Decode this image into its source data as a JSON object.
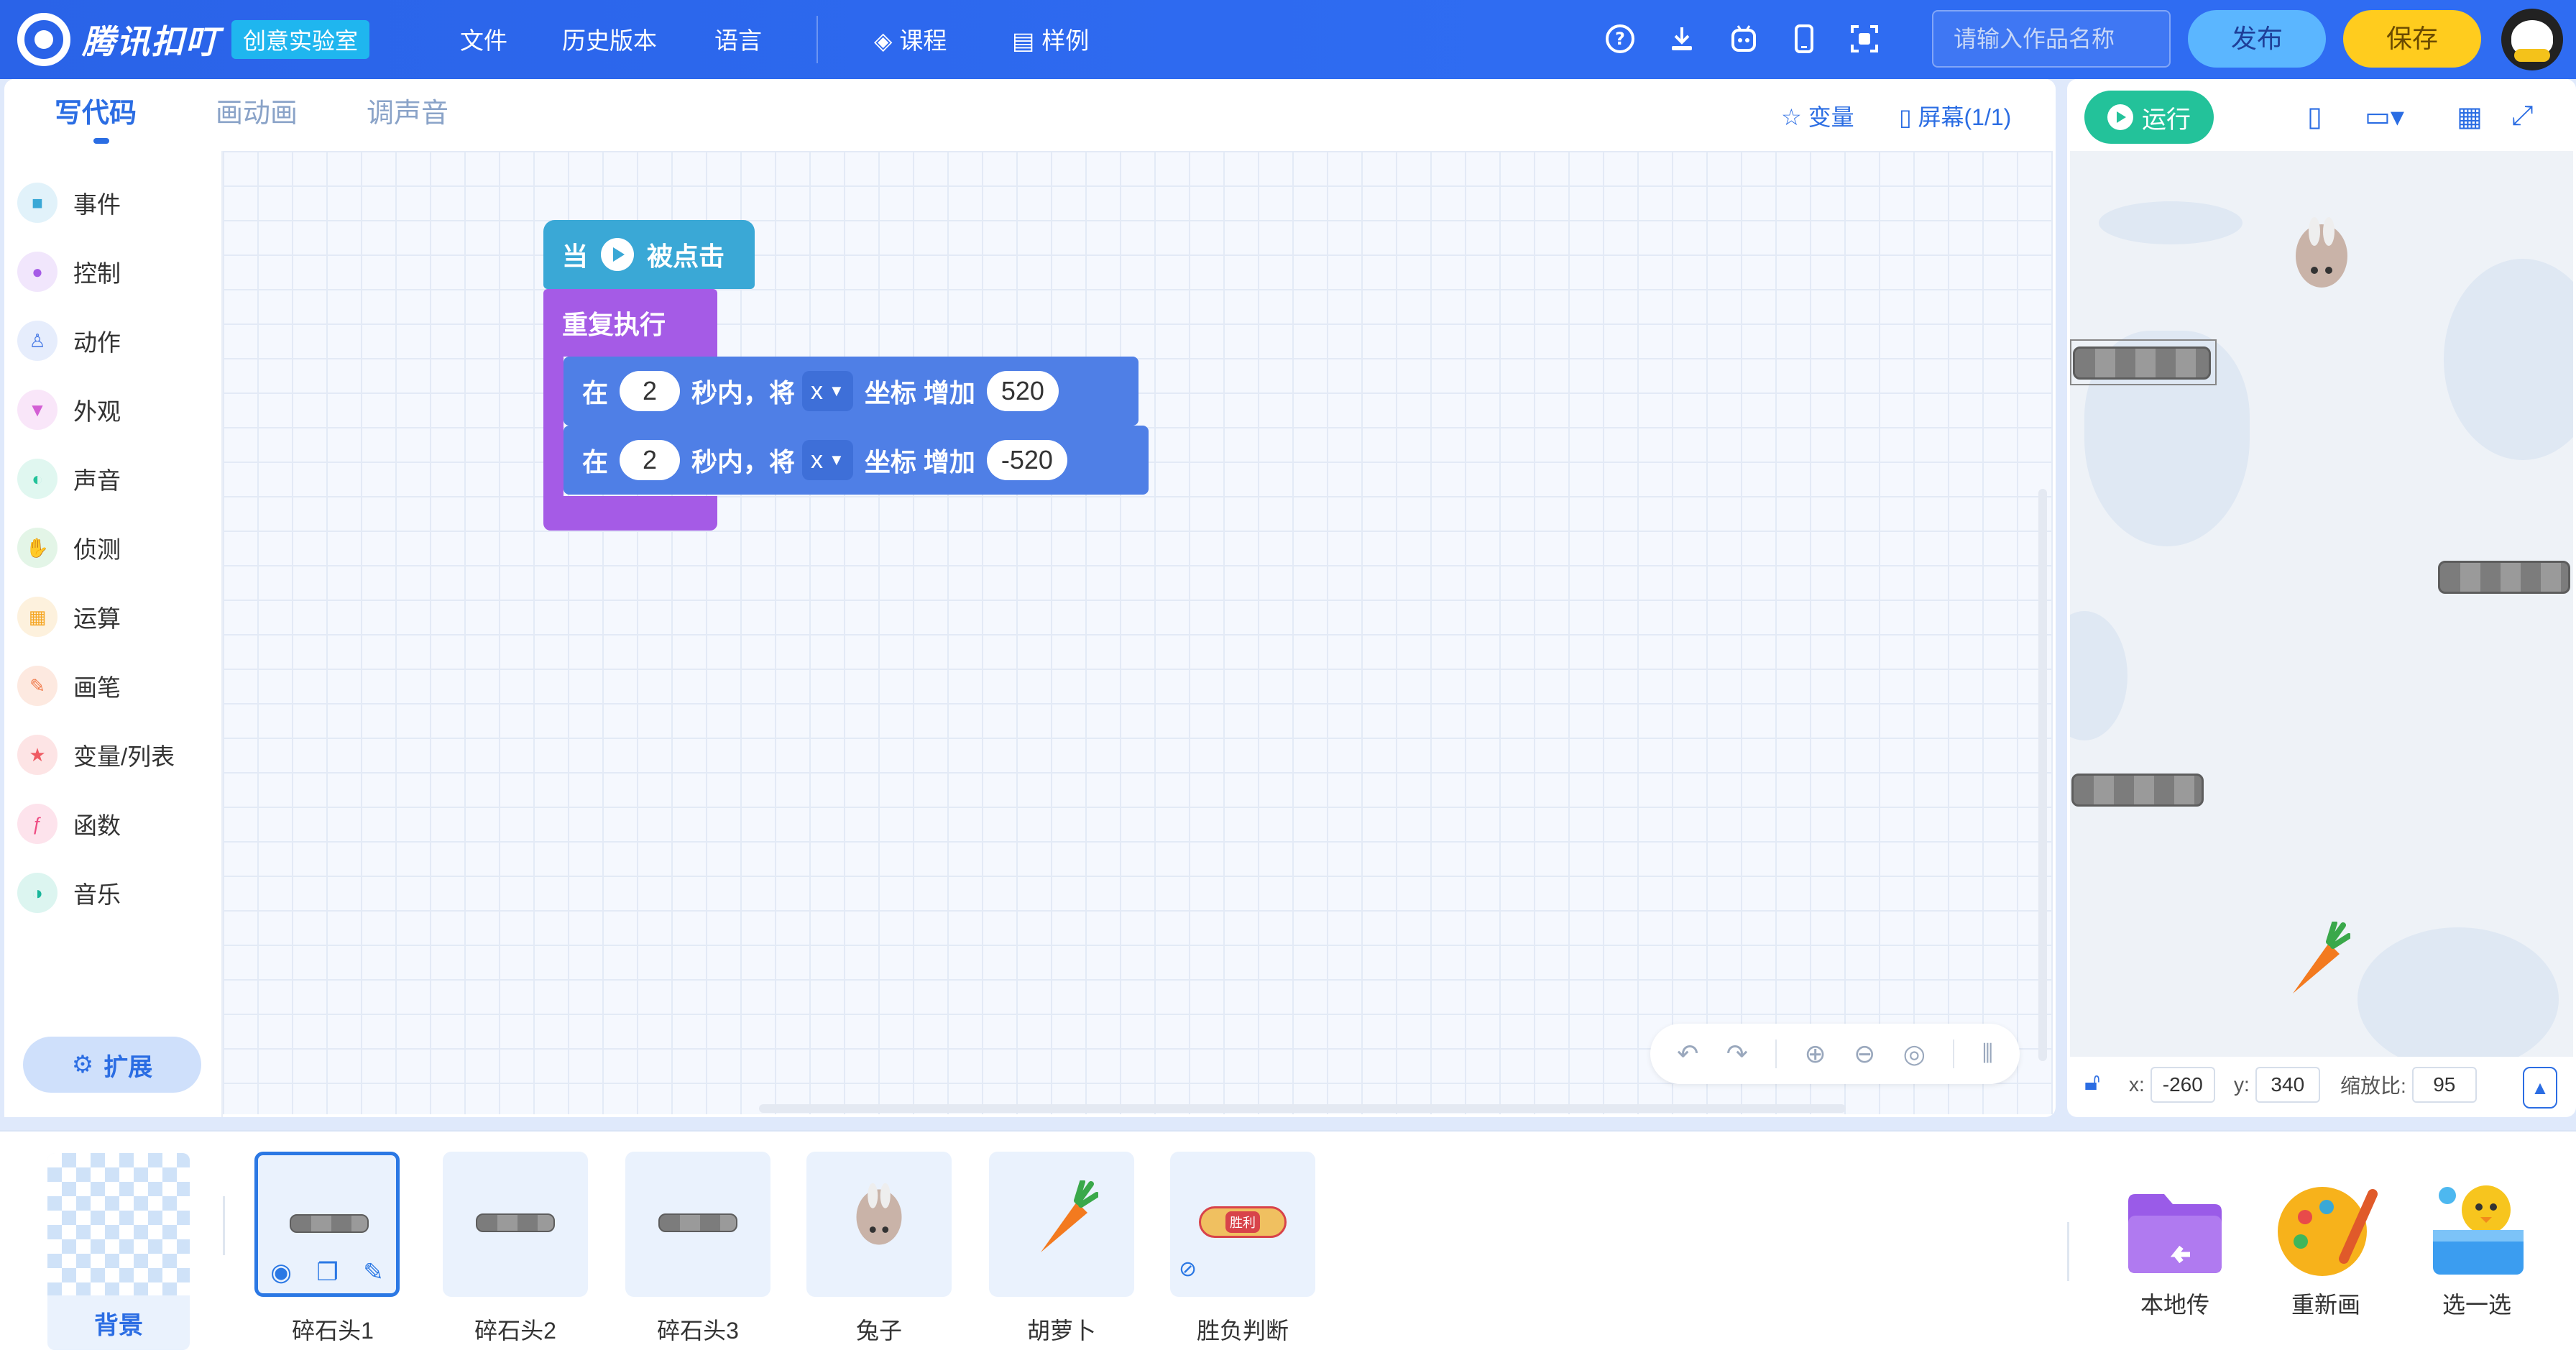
{
  "app": {
    "name": "腾讯扣叮",
    "badge": "创意实验室"
  },
  "menu": {
    "file": "文件",
    "history": "历史版本",
    "language": "语言",
    "course": "课程",
    "examples": "样例"
  },
  "topbar": {
    "search_placeholder": "请输入作品名称",
    "publish": "发布",
    "save": "保存"
  },
  "tabs": [
    "写代码",
    "画动画",
    "调声音"
  ],
  "code_tools": {
    "variables": "变量",
    "screen": "屏幕(1/1)"
  },
  "categories": [
    {
      "label": "事件",
      "color": "#3aa8d6"
    },
    {
      "label": "控制",
      "color": "#a55be6"
    },
    {
      "label": "动作",
      "color": "#4f7fe6"
    },
    {
      "label": "外观",
      "color": "#d35fd4"
    },
    {
      "label": "声音",
      "color": "#23c29a"
    },
    {
      "label": "侦测",
      "color": "#3fb65b"
    },
    {
      "label": "运算",
      "color": "#f5a623"
    },
    {
      "label": "画笔",
      "color": "#f07a4a"
    },
    {
      "label": "变量/列表",
      "color": "#ef5a62"
    },
    {
      "label": "函数",
      "color": "#ee4b82"
    },
    {
      "label": "音乐",
      "color": "#18b69a"
    }
  ],
  "extend": "扩展",
  "blocks": {
    "hat": {
      "when": "当",
      "clicked": "被点击"
    },
    "loop": "重复执行",
    "moves": [
      {
        "in": "在",
        "secs": "2",
        "text": "秒内，将",
        "axis": "x",
        "coord": "坐标 增加",
        "value": "520"
      },
      {
        "in": "在",
        "secs": "2",
        "text": "秒内，将",
        "axis": "x",
        "coord": "坐标 增加",
        "value": "-520"
      }
    ]
  },
  "stage": {
    "run": "运行",
    "x_label": "x:",
    "x": "-260",
    "y_label": "y:",
    "y": "340",
    "scale_label": "缩放比:",
    "scale": "95"
  },
  "background_label": "背景",
  "sprites": [
    {
      "label": "碎石头1",
      "selected": true
    },
    {
      "label": "碎石头2"
    },
    {
      "label": "碎石头3"
    },
    {
      "label": "兔子"
    },
    {
      "label": "胡萝卜"
    },
    {
      "label": "胜负判断",
      "badge_text": "胜利"
    }
  ],
  "tools": [
    {
      "label": "本地传",
      "icon": "folder-upload-icon"
    },
    {
      "label": "重新画",
      "icon": "palette-icon"
    },
    {
      "label": "选一选",
      "icon": "character-box-icon"
    }
  ]
}
